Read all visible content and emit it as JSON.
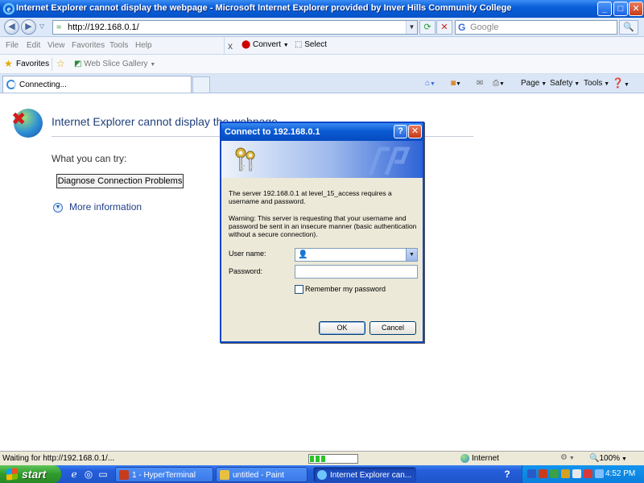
{
  "window": {
    "title": "Internet Explorer cannot display the webpage - Microsoft Internet Explorer provided by Inver Hills Community College",
    "minimize_glyph": "_",
    "maximize_glyph": "□",
    "close_glyph": "✕"
  },
  "address": {
    "url": "http://192.168.0.1/",
    "search_placeholder": "Google",
    "search_glyph": "🔍"
  },
  "menu": {
    "items": [
      "File",
      "Edit",
      "View",
      "Favorites",
      "Tools",
      "Help"
    ],
    "close_glyph": "x",
    "convert_label": "Convert",
    "select_label": "Select"
  },
  "favorites": {
    "label": "Favorites",
    "web_slice": "Web Slice Gallery"
  },
  "tab": {
    "label": "Connecting..."
  },
  "command_bar": {
    "page": "Page",
    "safety": "Safety",
    "tools": "Tools"
  },
  "error_page": {
    "title": "Internet Explorer cannot display the webpage",
    "try_heading": "What you can try:",
    "diagnose_button": "Diagnose Connection Problems",
    "more_info": "More information"
  },
  "dialog": {
    "title": "Connect to 192.168.0.1",
    "help_glyph": "?",
    "close_glyph": "✕",
    "message": "The server 192.168.0.1 at level_15_access requires a username and password.",
    "warning": "Warning: This server is requesting that your username and password be sent in an insecure manner (basic authentication without a secure connection).",
    "username_label": "User name:",
    "username_value": "",
    "password_label": "Password:",
    "password_value": "",
    "remember_label": "Remember my password",
    "remember_checked": false,
    "ok_label": "OK",
    "cancel_label": "Cancel"
  },
  "status": {
    "text": "Waiting for http://192.168.0.1/...",
    "progress_fraction": 0.35,
    "zone": "Internet",
    "zoom": "100%"
  },
  "taskbar": {
    "start_label": "start",
    "buttons": [
      {
        "label": "1 - HyperTerminal",
        "active": false
      },
      {
        "label": "untitled - Paint",
        "active": false
      },
      {
        "label": "Internet Explorer can...",
        "active": true
      }
    ],
    "help_glyph": "?",
    "clock": "4:52 PM"
  },
  "colors": {
    "title_blue": "#0a5fd8",
    "error_title": "#1f3f7a",
    "dialog_bg": "#ece9d8",
    "start_green": "#2f9a2c"
  }
}
